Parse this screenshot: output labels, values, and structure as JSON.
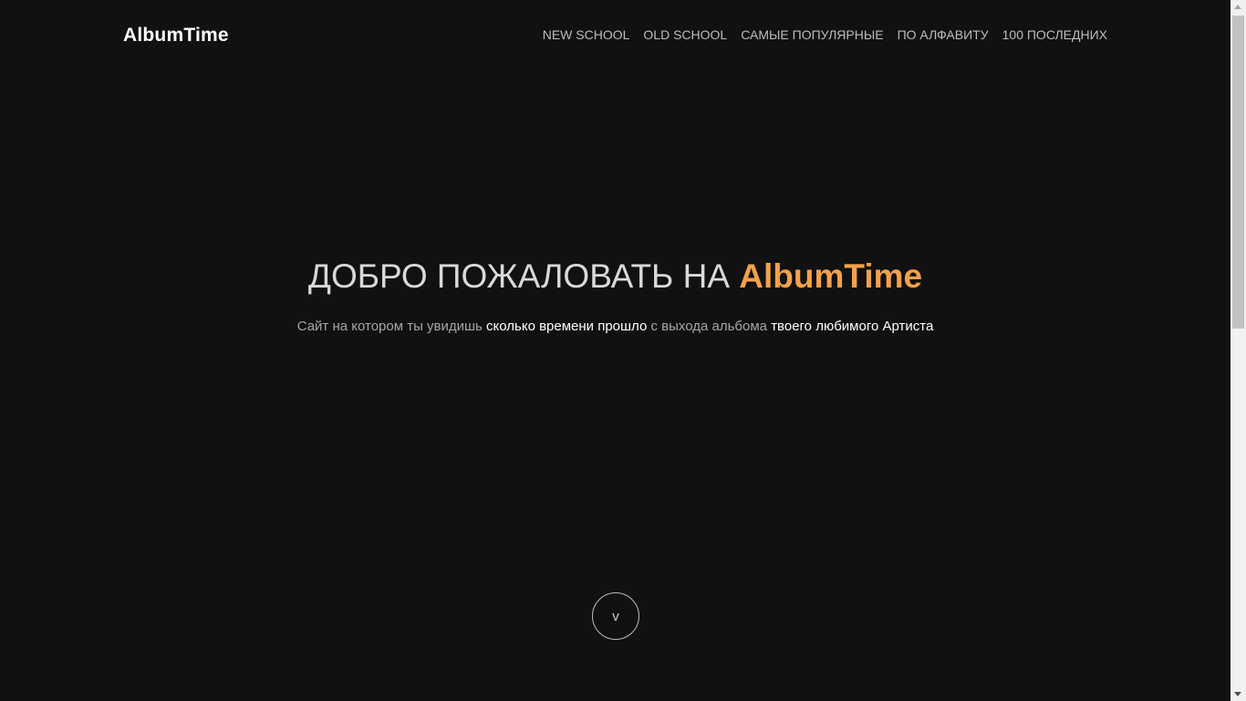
{
  "header": {
    "logo": "AlbumTime",
    "nav": [
      {
        "label": "NEW SCHOOL"
      },
      {
        "label": "OLD SCHOOL"
      },
      {
        "label": "САМЫЕ ПОПУЛЯРНЫЕ"
      },
      {
        "label": "ПО АЛФАВИТУ"
      },
      {
        "label": "100 ПОСЛЕДНИХ"
      }
    ]
  },
  "hero": {
    "title_prefix": "ДОБРО ПОЖАЛОВАТЬ НА ",
    "title_brand": "AlbumTime",
    "subtitle_part1": "Сайт на котором ты увидишь ",
    "subtitle_highlight1": "сколько времени прошло",
    "subtitle_part2": " с выхода альбома ",
    "subtitle_highlight2": "твоего любимого Артиста",
    "scroll_button": "v"
  },
  "colors": {
    "background": "#111111",
    "accent": "#f3a14a",
    "nav_text": "#bdbdbd"
  }
}
